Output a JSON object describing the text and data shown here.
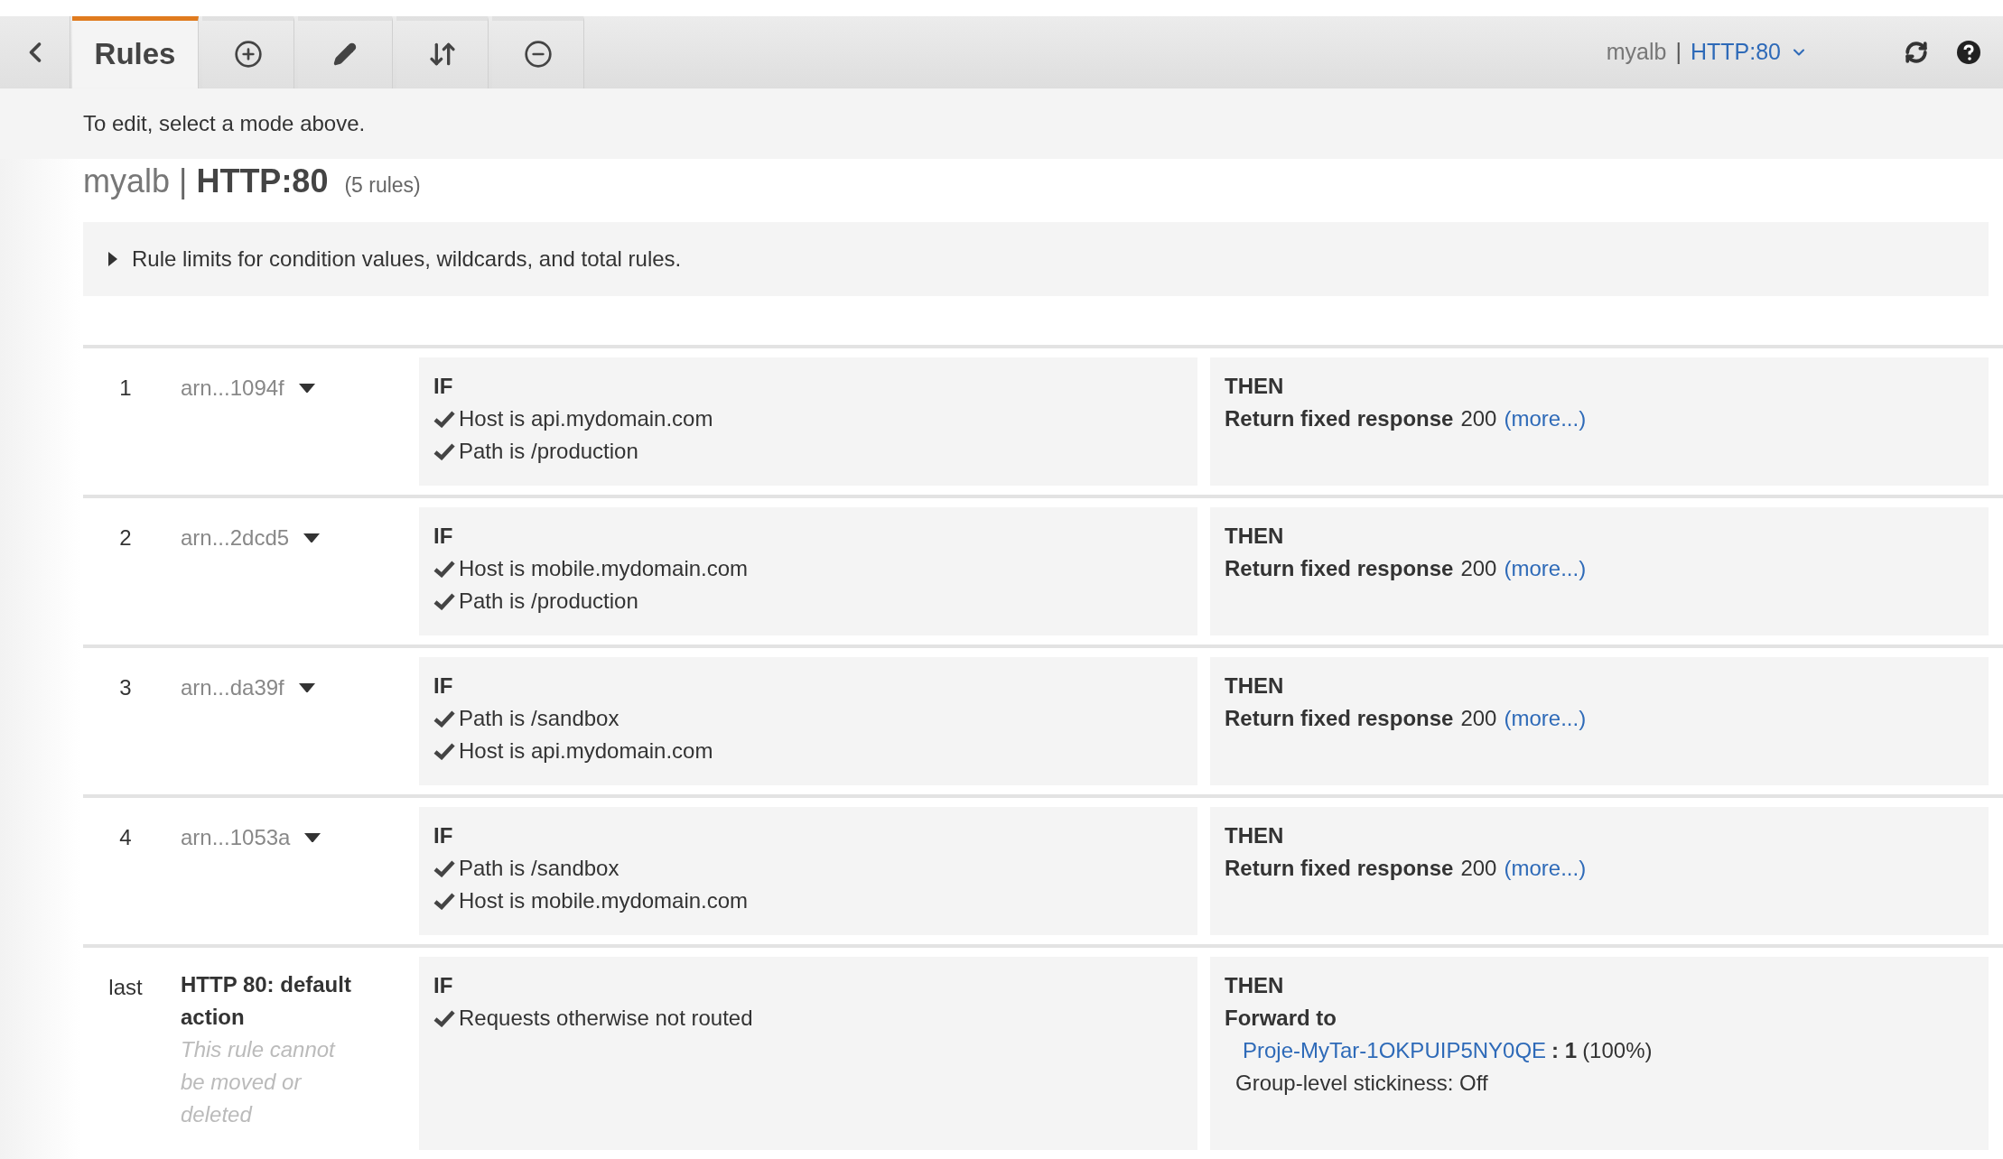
{
  "toolbar": {
    "tabs": [
      {
        "kind": "text",
        "label": "Rules",
        "selected": true
      },
      {
        "kind": "add",
        "selected": false
      },
      {
        "kind": "edit",
        "selected": false
      },
      {
        "kind": "reorder",
        "selected": false
      },
      {
        "kind": "delete",
        "selected": false
      }
    ],
    "selector": {
      "load_balancer": "myalb",
      "separator": "|",
      "listener": "HTTP:80"
    }
  },
  "hint": "To edit, select a mode above.",
  "heading": {
    "load_balancer": "myalb",
    "separator": "|",
    "listener": "HTTP:80",
    "count": "(5 rules)"
  },
  "limits": {
    "label": "Rule limits for condition values, wildcards, and total rules.",
    "expanded": false
  },
  "rules": [
    {
      "kind": "rule",
      "number": "1",
      "arn": "arn...1094f",
      "if_label": "IF",
      "conditions": [
        "Host is api.mydomain.com",
        "Path is /production"
      ],
      "then_label": "THEN",
      "action": {
        "kind": "fixed",
        "label": "Return fixed response",
        "value": "200",
        "link": "(more...)"
      }
    },
    {
      "kind": "rule",
      "number": "2",
      "arn": "arn...2dcd5",
      "if_label": "IF",
      "conditions": [
        "Host is mobile.mydomain.com",
        "Path is /production"
      ],
      "then_label": "THEN",
      "action": {
        "kind": "fixed",
        "label": "Return fixed response",
        "value": "200",
        "link": "(more...)"
      }
    },
    {
      "kind": "rule",
      "number": "3",
      "arn": "arn...da39f",
      "if_label": "IF",
      "conditions": [
        "Path is /sandbox",
        "Host is api.mydomain.com"
      ],
      "then_label": "THEN",
      "action": {
        "kind": "fixed",
        "label": "Return fixed response",
        "value": "200",
        "link": "(more...)"
      }
    },
    {
      "kind": "rule",
      "number": "4",
      "arn": "arn...1053a",
      "if_label": "IF",
      "conditions": [
        "Path is /sandbox",
        "Host is mobile.mydomain.com"
      ],
      "then_label": "THEN",
      "action": {
        "kind": "fixed",
        "label": "Return fixed response",
        "value": "200",
        "link": "(more...)"
      }
    },
    {
      "kind": "default",
      "number": "last",
      "title": "HTTP 80: default action",
      "note": "This rule cannot be moved or deleted",
      "if_label": "IF",
      "conditions": [
        "Requests otherwise not routed"
      ],
      "then_label": "THEN",
      "action": {
        "kind": "forward",
        "label": "Forward to",
        "target": "Proje-MyTar-1OKPUIP5NY0QE",
        "separator": ":",
        "weight": "1",
        "percent": "(100%)",
        "stickiness": "Group-level stickiness: Off"
      }
    }
  ]
}
